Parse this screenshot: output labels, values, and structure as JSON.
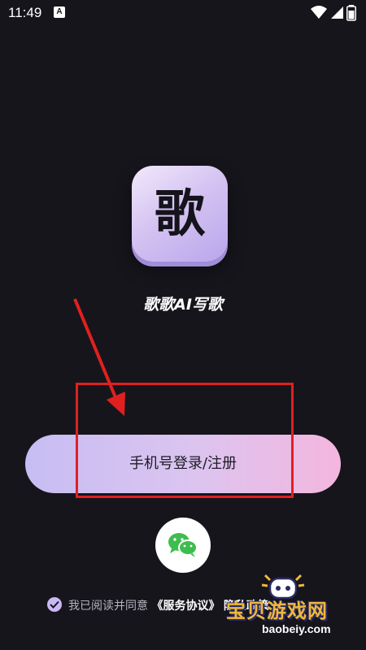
{
  "status_bar": {
    "time": "11:49",
    "notification_icon": "a-box-icon",
    "right_icons": [
      "wifi-icon",
      "signal-icon",
      "battery-icon"
    ]
  },
  "app": {
    "logo_glyph": "歌",
    "name": "歌歌AI写歌"
  },
  "login": {
    "phone_button_label": "手机号登录/注册",
    "wechat_button_icon": "wechat-icon"
  },
  "agreement": {
    "prefix": "我已阅读并同意",
    "service_agreement": "《服务协议》",
    "privacy_partial": "隐私政策"
  },
  "annotation": {
    "color": "#e02020"
  },
  "watermark": {
    "text": "宝贝游戏网",
    "url": "baobeiy.com"
  },
  "colors": {
    "background": "#16151c",
    "button_gradient_start": "#c7bdf3",
    "button_gradient_end": "#f4b6de",
    "wechat_green": "#3ebd4f",
    "checkbox": "#c9b8f3"
  }
}
